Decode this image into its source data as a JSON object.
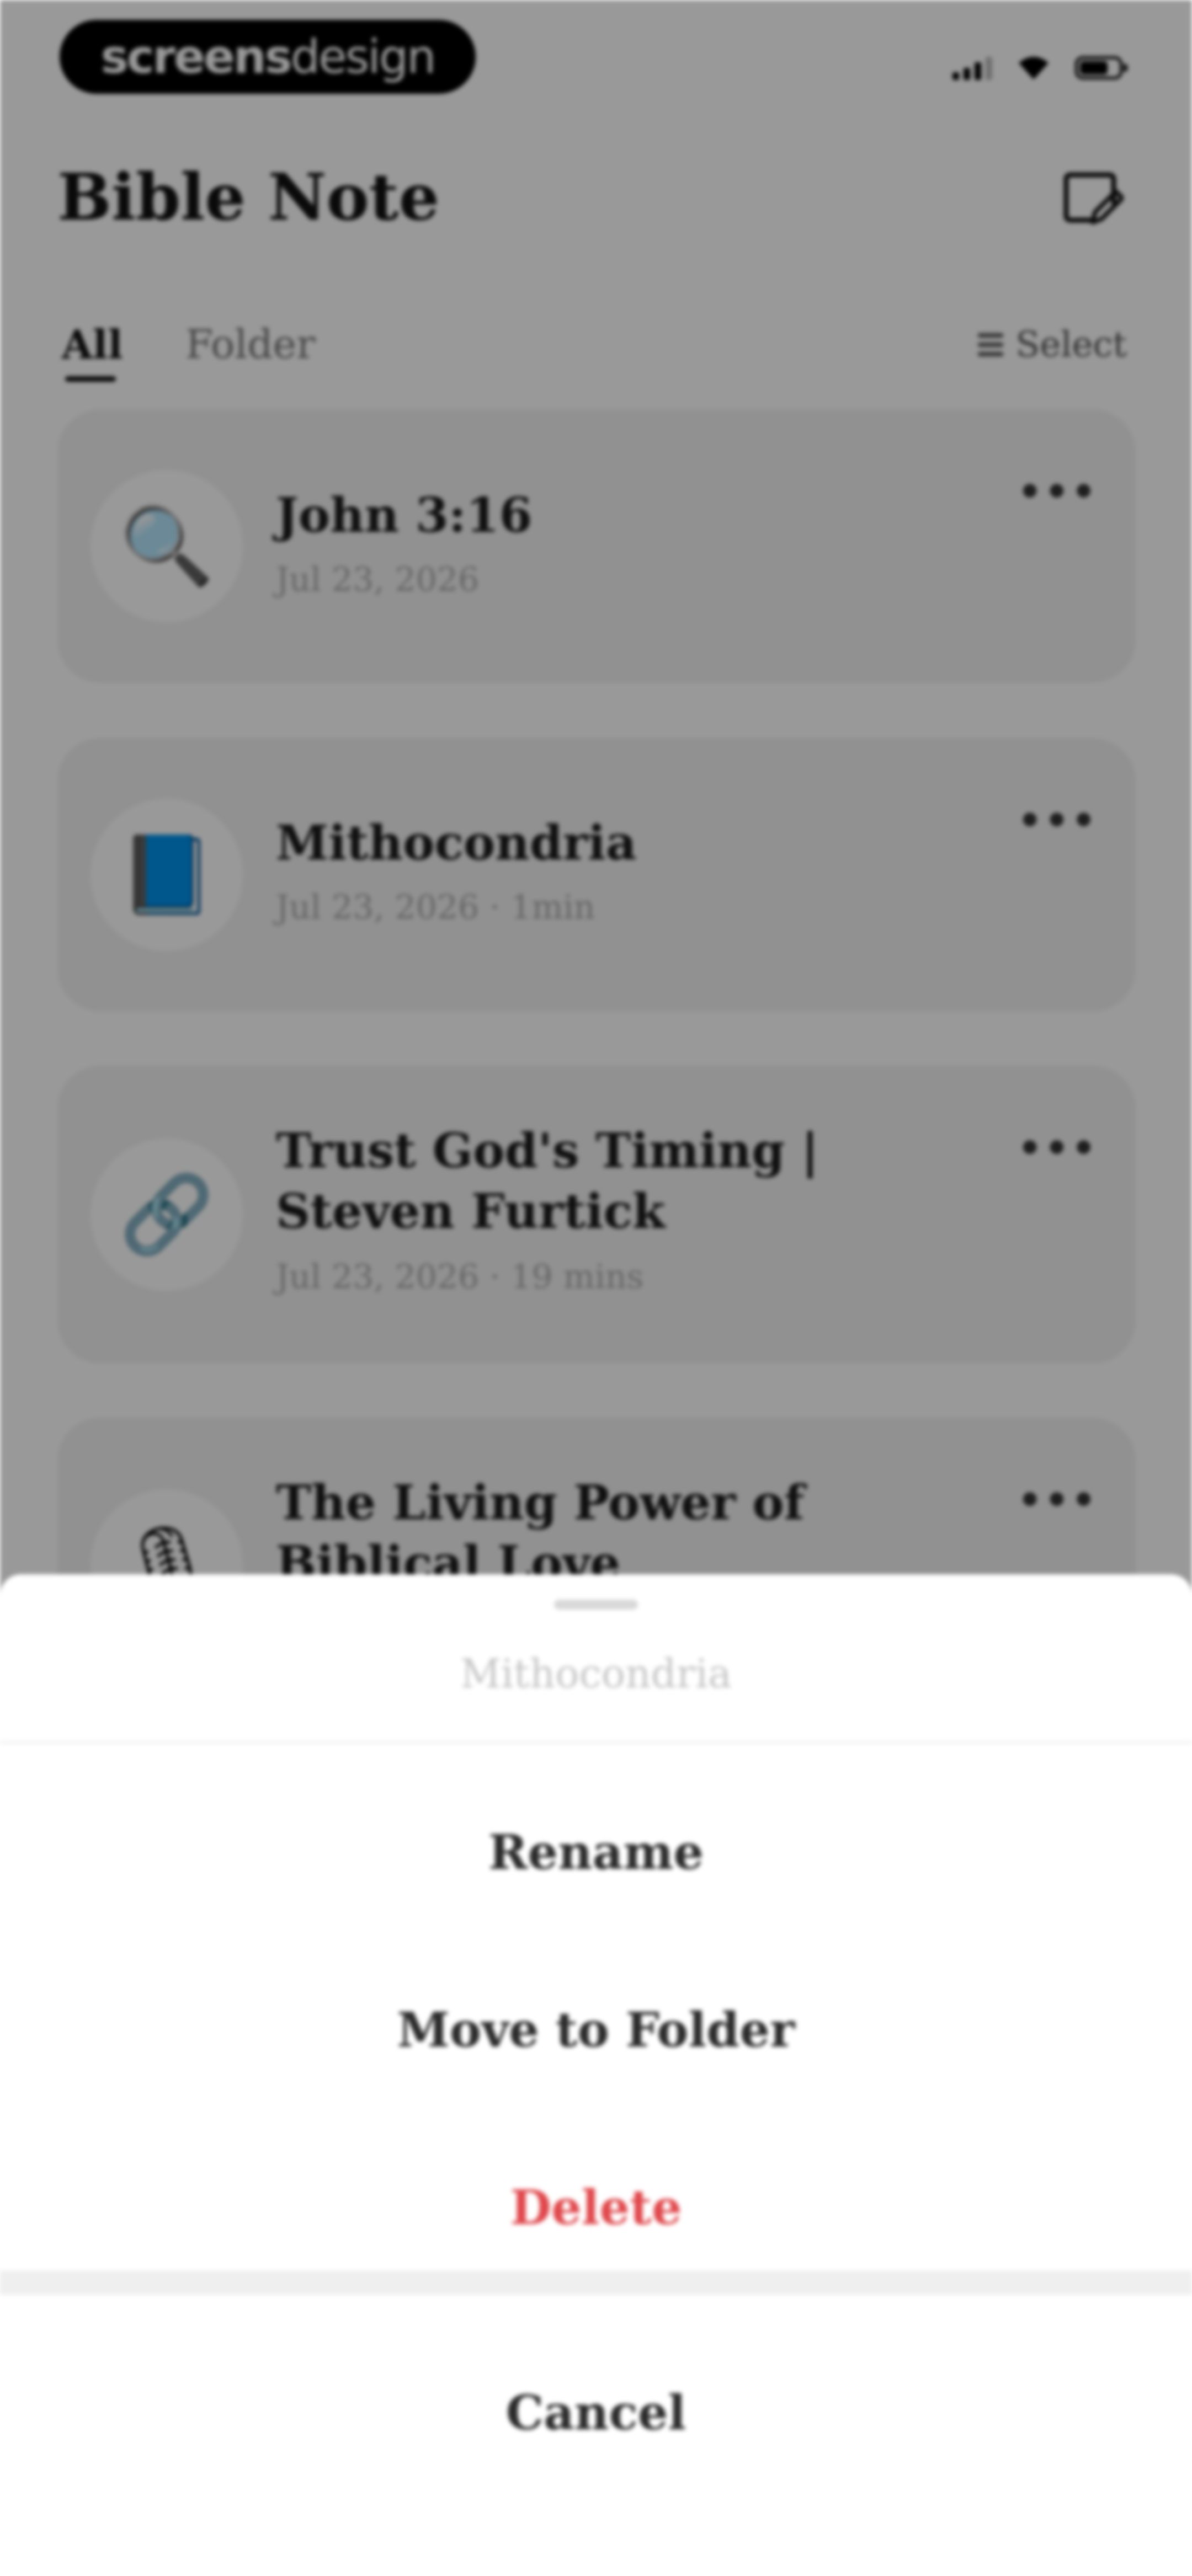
{
  "status_bar": {
    "brand_part1": "screens",
    "brand_part2": "design",
    "signal_icon": "cellular-signal-icon",
    "wifi_icon": "wifi-icon",
    "battery_icon": "battery-icon"
  },
  "header": {
    "title": "Bible Note",
    "new_note_icon": "new-note-icon"
  },
  "tabs": [
    {
      "label": "All",
      "selected": true
    },
    {
      "label": "Folder",
      "selected": false
    }
  ],
  "select_label": "Select",
  "notes": [
    {
      "title": "John 3:16",
      "meta": "Jul 23, 2026",
      "icon": "🔍",
      "icon_name": "magnifier-icon"
    },
    {
      "title": "Mithocondria",
      "meta": "Jul 23, 2026 · 1min",
      "icon": "📘",
      "icon_name": "book-icon"
    },
    {
      "title": "Trust God's Timing | Steven Furtick",
      "meta": "Jul 23, 2026 · 19 mins",
      "icon": "🔗",
      "icon_name": "link-icon"
    },
    {
      "title": "The Living Power of Biblical Love",
      "meta": "",
      "icon": "🎙",
      "icon_name": "microphone-icon"
    }
  ],
  "more_glyph": "•••",
  "action_sheet": {
    "title": "Mithocondria",
    "actions": [
      {
        "label": "Rename",
        "color": "#2a2a2a"
      },
      {
        "label": "Move to Folder",
        "color": "#2a2a2a"
      },
      {
        "label": "Delete",
        "color": "#e0484c"
      }
    ],
    "cancel_label": "Cancel"
  },
  "colors": {
    "delete": "#e0484c",
    "overlay": "rgba(0,0,0,0.4)",
    "card_background": "#f2f2f2"
  }
}
